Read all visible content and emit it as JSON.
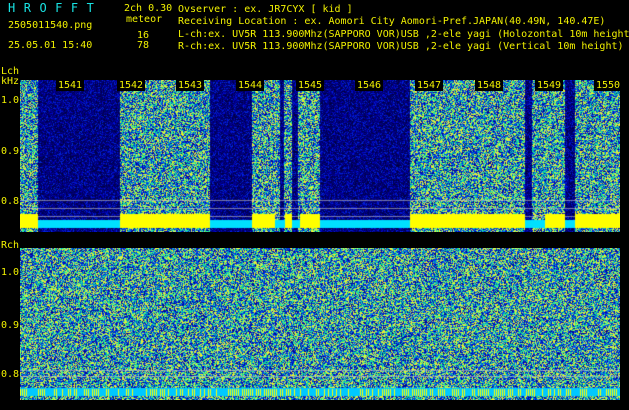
{
  "header": {
    "app_title": "HROFFT",
    "version": "2ch 0.30",
    "meteor_label": "meteor",
    "filename": "2505011540.png",
    "count_l": "16",
    "datetime": "25.05.01 15:40",
    "count_r": "78",
    "observer": "Ovserver           : ex. JR7CYX [ kid ]",
    "location": "Receiving Location : ex. Aomori City Aomori-Pref.JAPAN(40.49N, 140.47E)",
    "lch_info": "L-ch:ex. UV5R 113.900Mhz(SAPPORO VOR)USB ,2-ele yagi (Holozontal 10m height",
    "rch_info": "R-ch:ex. UV5R 113.900Mhz(SAPPORO VOR)USB ,2-ele yagi (Vertical 10m height)"
  },
  "left_channel": {
    "label": "Lch",
    "unit": "kHz",
    "yticks": [
      "1.0",
      "0.9",
      "0.8"
    ],
    "time_labels": [
      "1541",
      "1542",
      "1543",
      "1544",
      "1545",
      "1546",
      "1547",
      "1548",
      "1549",
      "1550"
    ]
  },
  "right_channel": {
    "label": "Rch",
    "yticks": [
      "1.0",
      "0.9",
      "0.8"
    ]
  },
  "colors": {
    "background": "#000000",
    "text": "#f2f200",
    "title": "#19e3e3",
    "signal": "#ffff00",
    "noise_floor": "#00e0ff"
  }
}
